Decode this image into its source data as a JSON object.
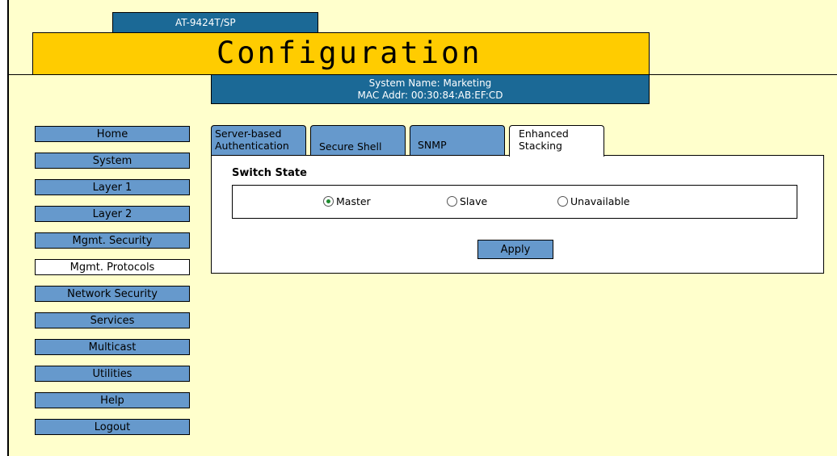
{
  "header": {
    "model": "AT-9424T/SP",
    "title": "Configuration",
    "system_name": "System Name: Marketing",
    "mac_addr": "MAC Addr: 00:30:84:AB:EF:CD"
  },
  "sidebar": {
    "items": [
      {
        "label": "Home"
      },
      {
        "label": "System"
      },
      {
        "label": "Layer 1"
      },
      {
        "label": "Layer 2"
      },
      {
        "label": "Mgmt. Security"
      },
      {
        "label": "Mgmt. Protocols",
        "selected": true
      },
      {
        "label": "Network Security"
      },
      {
        "label": "Services"
      },
      {
        "label": "Multicast"
      },
      {
        "label": "Utilities"
      },
      {
        "label": "Help"
      },
      {
        "label": "Logout"
      }
    ]
  },
  "tabs": [
    {
      "line1": "Server-based",
      "line2": "Authentication"
    },
    {
      "line1": "",
      "line2": "Secure Shell"
    },
    {
      "line1": "",
      "line2": "SNMP"
    },
    {
      "line1": "Enhanced",
      "line2": "Stacking",
      "active": true
    }
  ],
  "main": {
    "section_label": "Switch State",
    "options": [
      {
        "label": "Master",
        "checked": true
      },
      {
        "label": "Slave",
        "checked": false
      },
      {
        "label": "Unavailable",
        "checked": false
      }
    ],
    "apply_label": "Apply"
  },
  "colors": {
    "background": "#ffffcc",
    "banner": "#ffcc00",
    "header_blue": "#1b6996",
    "button_blue": "#6699cc",
    "selected": "#ffffff"
  }
}
